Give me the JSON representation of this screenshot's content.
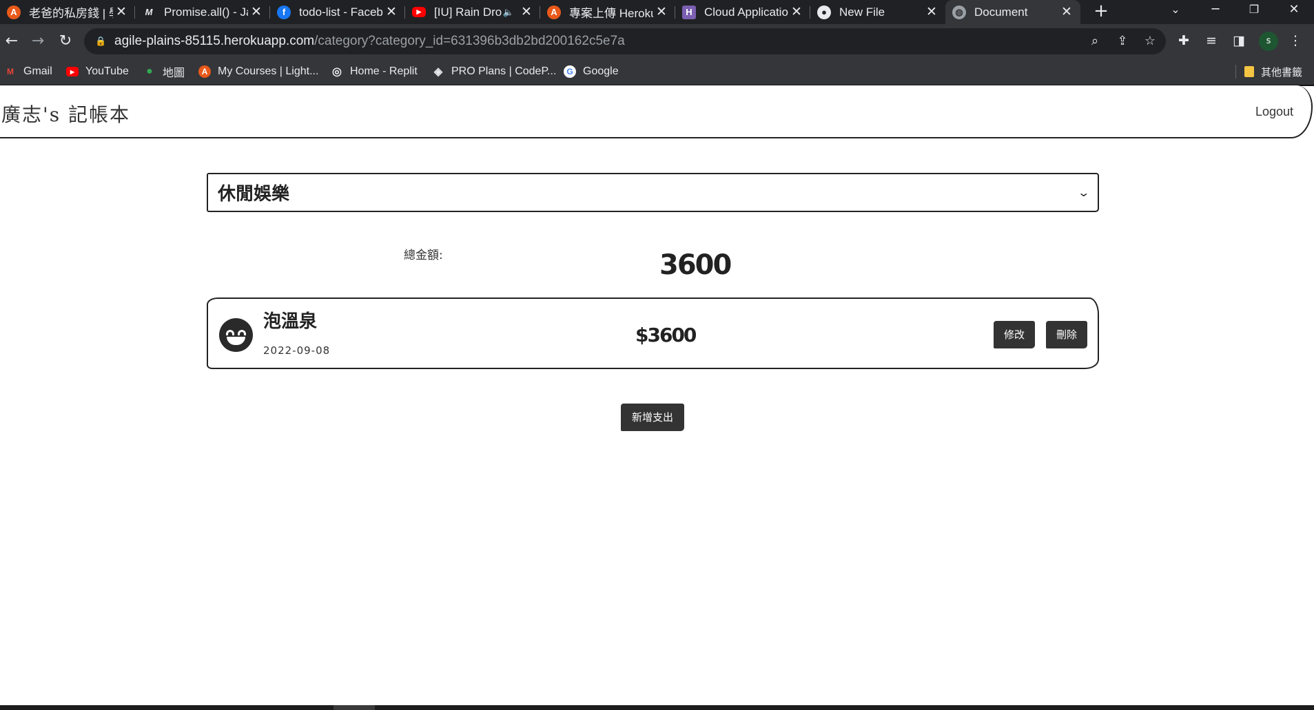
{
  "browser": {
    "tabs": [
      {
        "title": "老爸的私房錢 | 學",
        "favicon": "alpha-camp-icon",
        "color": "#e8591a",
        "glyph": "A"
      },
      {
        "title": "Promise.all() - Ja",
        "favicon": "mdn-icon",
        "color": "#202124",
        "glyph": "M"
      },
      {
        "title": "todo-list - Faceb",
        "favicon": "facebook-icon",
        "color": "#1877f2",
        "glyph": "f"
      },
      {
        "title": "[IU] Rain Dro",
        "favicon": "youtube-icon",
        "color": "#ff0000",
        "glyph": "▶"
      },
      {
        "title": "專案上傳 Heroku",
        "favicon": "alpha-camp-icon",
        "color": "#e8591a",
        "glyph": "A"
      },
      {
        "title": "Cloud Applicatio",
        "favicon": "heroku-icon",
        "color": "#7b5fb1",
        "glyph": "H"
      },
      {
        "title": "New File",
        "favicon": "github-icon",
        "color": "#e8eaed",
        "glyph": "●"
      },
      {
        "title": "Document",
        "favicon": "globe-icon",
        "color": "#9aa0a6",
        "glyph": "◍"
      }
    ],
    "address": {
      "host": "agile-plains-85115.herokuapp.com",
      "path": "/category?category_id=631396b3db2bd200162c5e7a"
    },
    "profile_initial": "s",
    "bookmarks": [
      {
        "label": "Gmail",
        "icon": "gmail-icon",
        "color": "#ea4335",
        "glyph": "M"
      },
      {
        "label": "YouTube",
        "icon": "youtube-icon",
        "color": "#ff0000",
        "glyph": "▶"
      },
      {
        "label": "地圖",
        "icon": "maps-pin-icon",
        "color": "#34a853",
        "glyph": "●"
      },
      {
        "label": "My Courses | Light...",
        "icon": "alpha-camp-icon",
        "color": "#e8591a",
        "glyph": "A"
      },
      {
        "label": "Home - Replit",
        "icon": "replit-icon",
        "color": "#e8eaed",
        "glyph": "◎"
      },
      {
        "label": "PRO Plans | CodeP...",
        "icon": "codepen-icon",
        "color": "#e8eaed",
        "glyph": "◈"
      },
      {
        "label": "Google",
        "icon": "google-icon",
        "color": "#4285f4",
        "glyph": "G"
      }
    ],
    "other_bookmarks": "其他書籤"
  },
  "app": {
    "brand": "廣志's 記帳本",
    "logout": "Logout",
    "category_selected": "休閒娛樂",
    "total_label": "總金額:",
    "total_value": "3600",
    "records": [
      {
        "name": "泡溫泉",
        "date": "2022-09-08",
        "amount": "$3600",
        "icon": "grinning-face-icon"
      }
    ],
    "edit_label": "修改",
    "delete_label": "刪除",
    "add_label": "新增支出"
  }
}
